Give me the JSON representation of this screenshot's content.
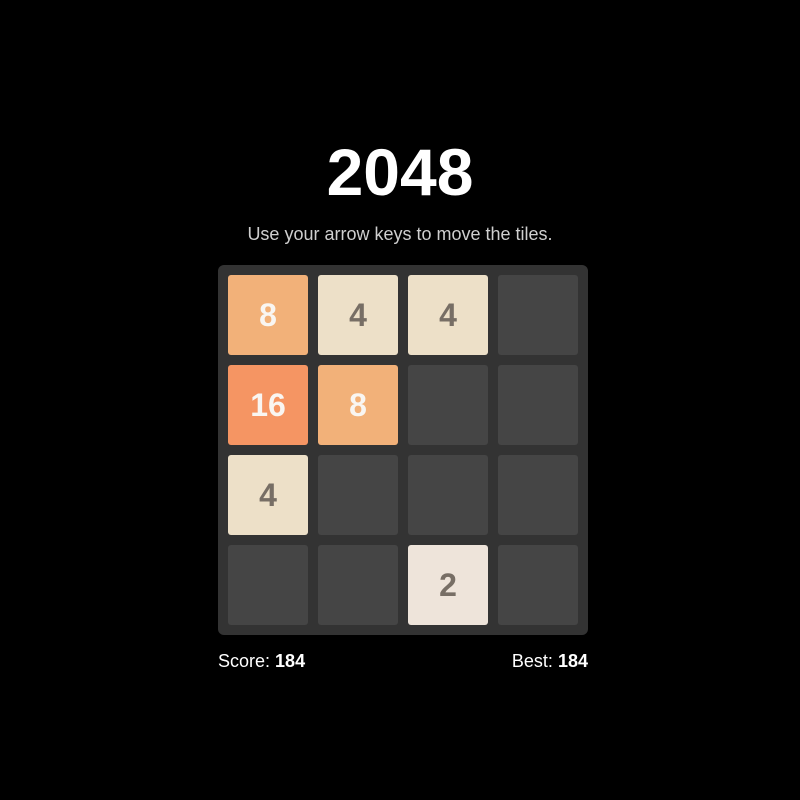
{
  "header": {
    "title": "2048",
    "subtitle": "Use your arrow keys to move the tiles."
  },
  "board": {
    "size": 4,
    "cells": [
      [
        "8",
        "4",
        "4",
        ""
      ],
      [
        "16",
        "8",
        "",
        ""
      ],
      [
        "4",
        "",
        "",
        ""
      ],
      [
        "",
        "",
        "2",
        ""
      ]
    ]
  },
  "footer": {
    "score_label": "Score:",
    "score_value": "184",
    "best_label": "Best:",
    "best_value": "184"
  },
  "colors": {
    "background": "#000000",
    "board": "#333333",
    "empty_cell": "#454545",
    "tile_2": "#eee4da",
    "tile_4": "#ede0c8",
    "tile_8": "#f2b179",
    "tile_16": "#f59563"
  }
}
